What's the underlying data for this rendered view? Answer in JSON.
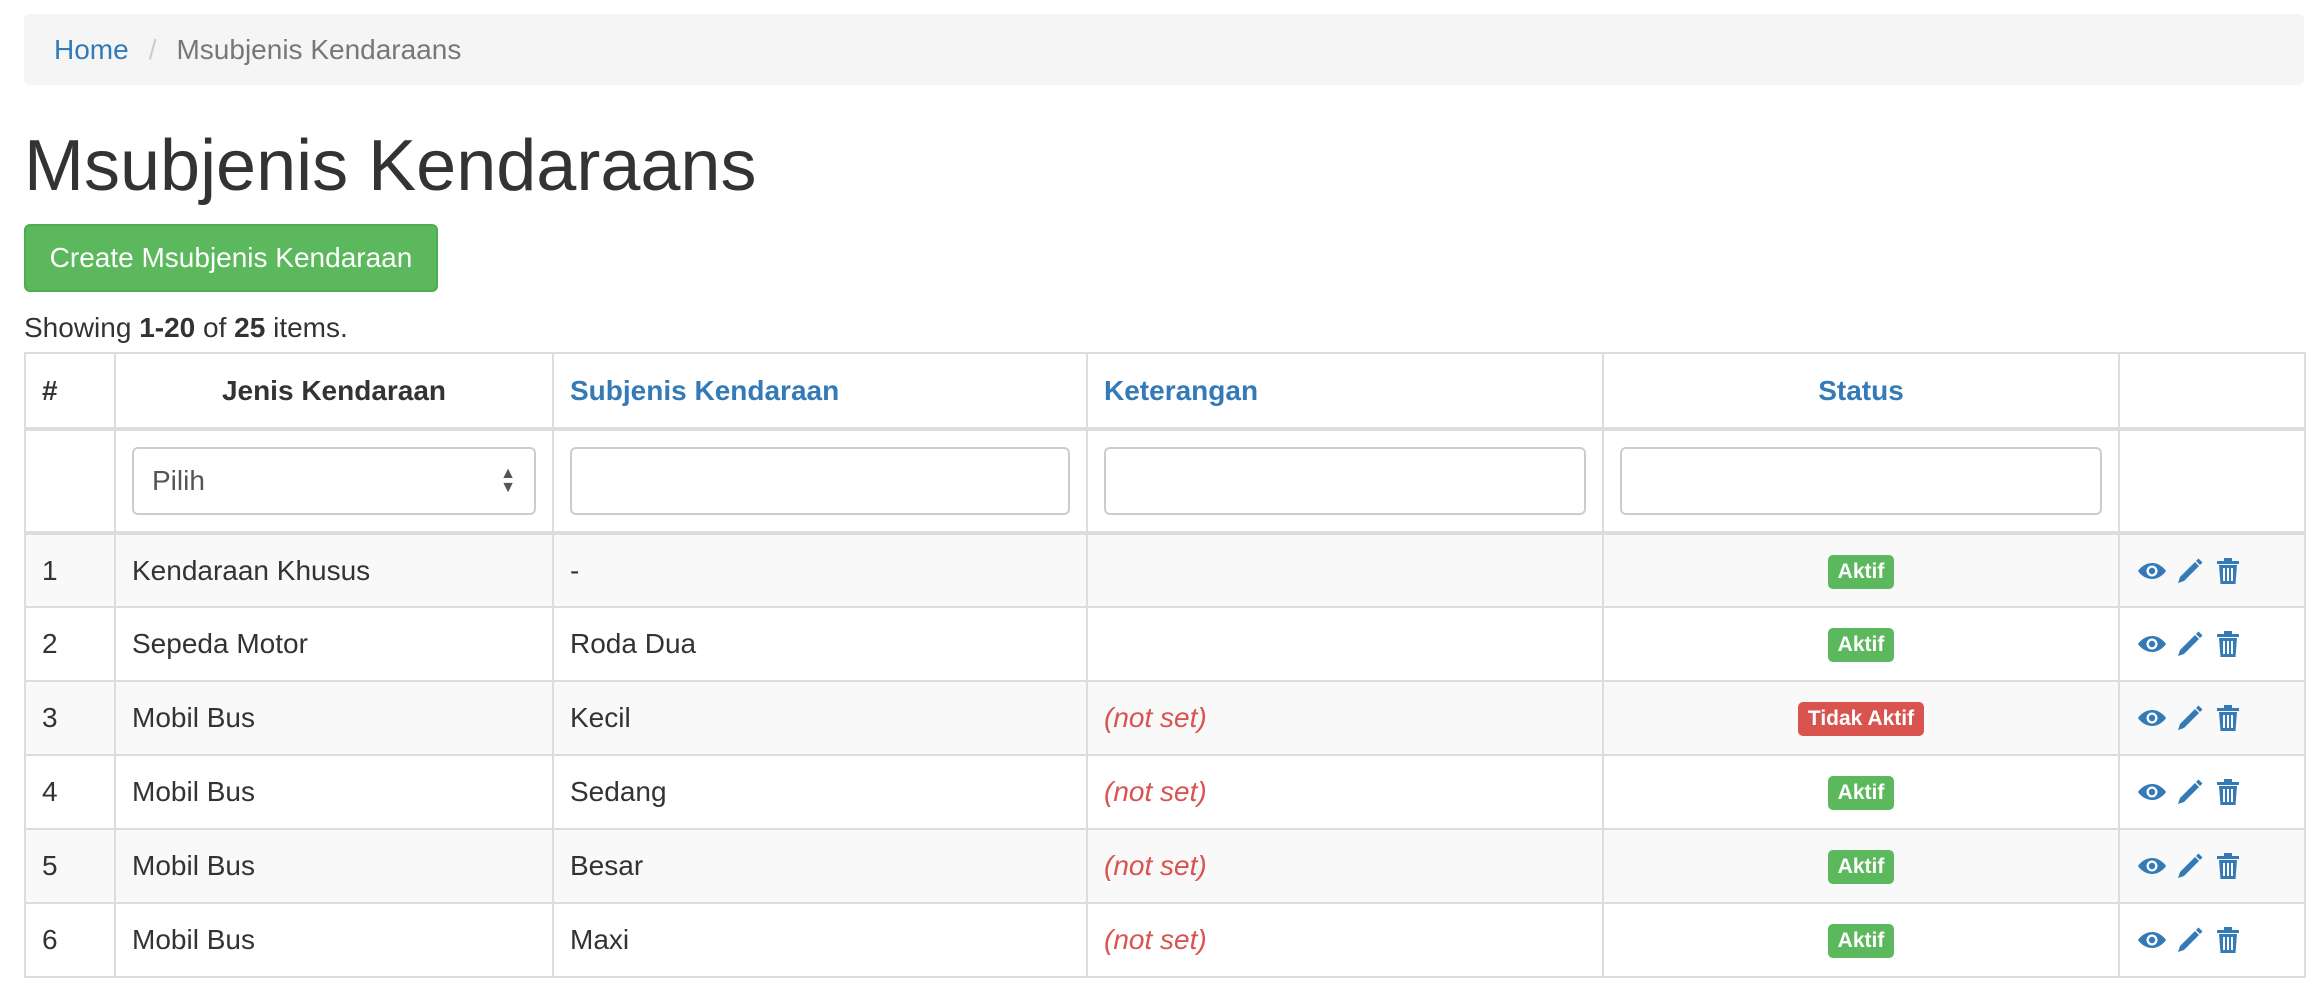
{
  "breadcrumb": {
    "home": "Home",
    "separator": "/",
    "current": "Msubjenis Kendaraans"
  },
  "page_title": "Msubjenis Kendaraans",
  "create_button": "Create Msubjenis Kendaraan",
  "summary": {
    "prefix": "Showing ",
    "range": "1-20",
    "middle": " of ",
    "total": "25",
    "suffix": " items."
  },
  "table": {
    "headers": {
      "index": "#",
      "jenis": "Jenis Kendaraan",
      "subjenis": "Subjenis Kendaraan",
      "keterangan": "Keterangan",
      "status": "Status"
    },
    "filters": {
      "jenis_selected": "Pilih",
      "subjenis_value": "",
      "keterangan_value": "",
      "status_value": ""
    },
    "rows": [
      {
        "no": "1",
        "jenis": "Kendaraan Khusus",
        "subjenis": "-",
        "keterangan": "",
        "status": "Aktif"
      },
      {
        "no": "2",
        "jenis": "Sepeda Motor",
        "subjenis": "Roda Dua",
        "keterangan": "",
        "status": "Aktif"
      },
      {
        "no": "3",
        "jenis": "Mobil Bus",
        "subjenis": "Kecil",
        "keterangan": "(not set)",
        "status": "Tidak Aktif"
      },
      {
        "no": "4",
        "jenis": "Mobil Bus",
        "subjenis": "Sedang",
        "keterangan": "(not set)",
        "status": "Aktif"
      },
      {
        "no": "5",
        "jenis": "Mobil Bus",
        "subjenis": "Besar",
        "keterangan": "(not set)",
        "status": "Aktif"
      },
      {
        "no": "6",
        "jenis": "Mobil Bus",
        "subjenis": "Maxi",
        "keterangan": "(not set)",
        "status": "Aktif"
      }
    ]
  },
  "colors": {
    "link": "#337ab7",
    "success": "#5cb85c",
    "danger": "#d9534f"
  },
  "icons": {
    "view": "eye-icon",
    "update": "pencil-icon",
    "delete": "trash-icon"
  }
}
